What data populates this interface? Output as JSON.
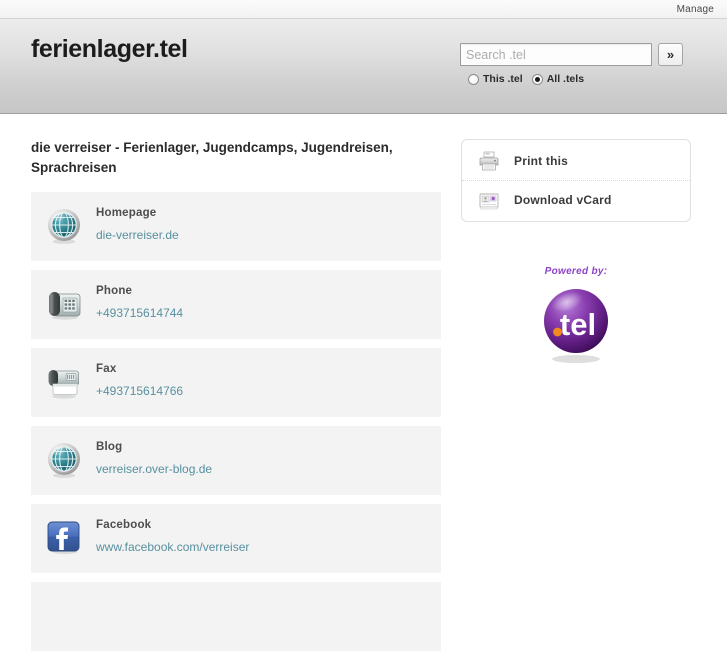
{
  "topbar": {
    "links": [
      {
        "label": "Manage",
        "name": "manage-link"
      }
    ]
  },
  "header": {
    "site_title": "ferienlager.tel",
    "search": {
      "value": "",
      "placeholder": "Search .tel",
      "submit_label": "»",
      "scope_options": [
        {
          "label": "This .tel",
          "selected": false
        },
        {
          "label": "All .tels",
          "selected": true
        }
      ]
    }
  },
  "main": {
    "heading": "die verreiser - Ferienlager, Jugendcamps, Jugendreisen, Sprachreisen",
    "records": [
      {
        "icon": "globe-icon",
        "label": "Homepage",
        "value": "die-verreiser.de"
      },
      {
        "icon": "phone-icon",
        "label": "Phone",
        "value": "+493715614744"
      },
      {
        "icon": "fax-icon",
        "label": "Fax",
        "value": "+493715614766"
      },
      {
        "icon": "globe-icon",
        "label": "Blog",
        "value": "verreiser.over-blog.de"
      },
      {
        "icon": "facebook-icon",
        "label": "Facebook",
        "value": "www.facebook.com/verreiser"
      }
    ]
  },
  "sidebar": {
    "actions": [
      {
        "icon": "printer-icon",
        "label": "Print this"
      },
      {
        "icon": "vcard-icon",
        "label": "Download vCard"
      }
    ],
    "powered_by_text": "Powered by:",
    "logo_text": ".tel"
  },
  "colors": {
    "link": "#57909e",
    "record_bg": "#f3f3f3",
    "powered_by": "#8e44c8",
    "logo_purple": "#6d2a8e",
    "logo_dot_orange": "#f08a1c",
    "facebook_blue": "#3b5998",
    "globe_teal": "#2d7f8c"
  }
}
